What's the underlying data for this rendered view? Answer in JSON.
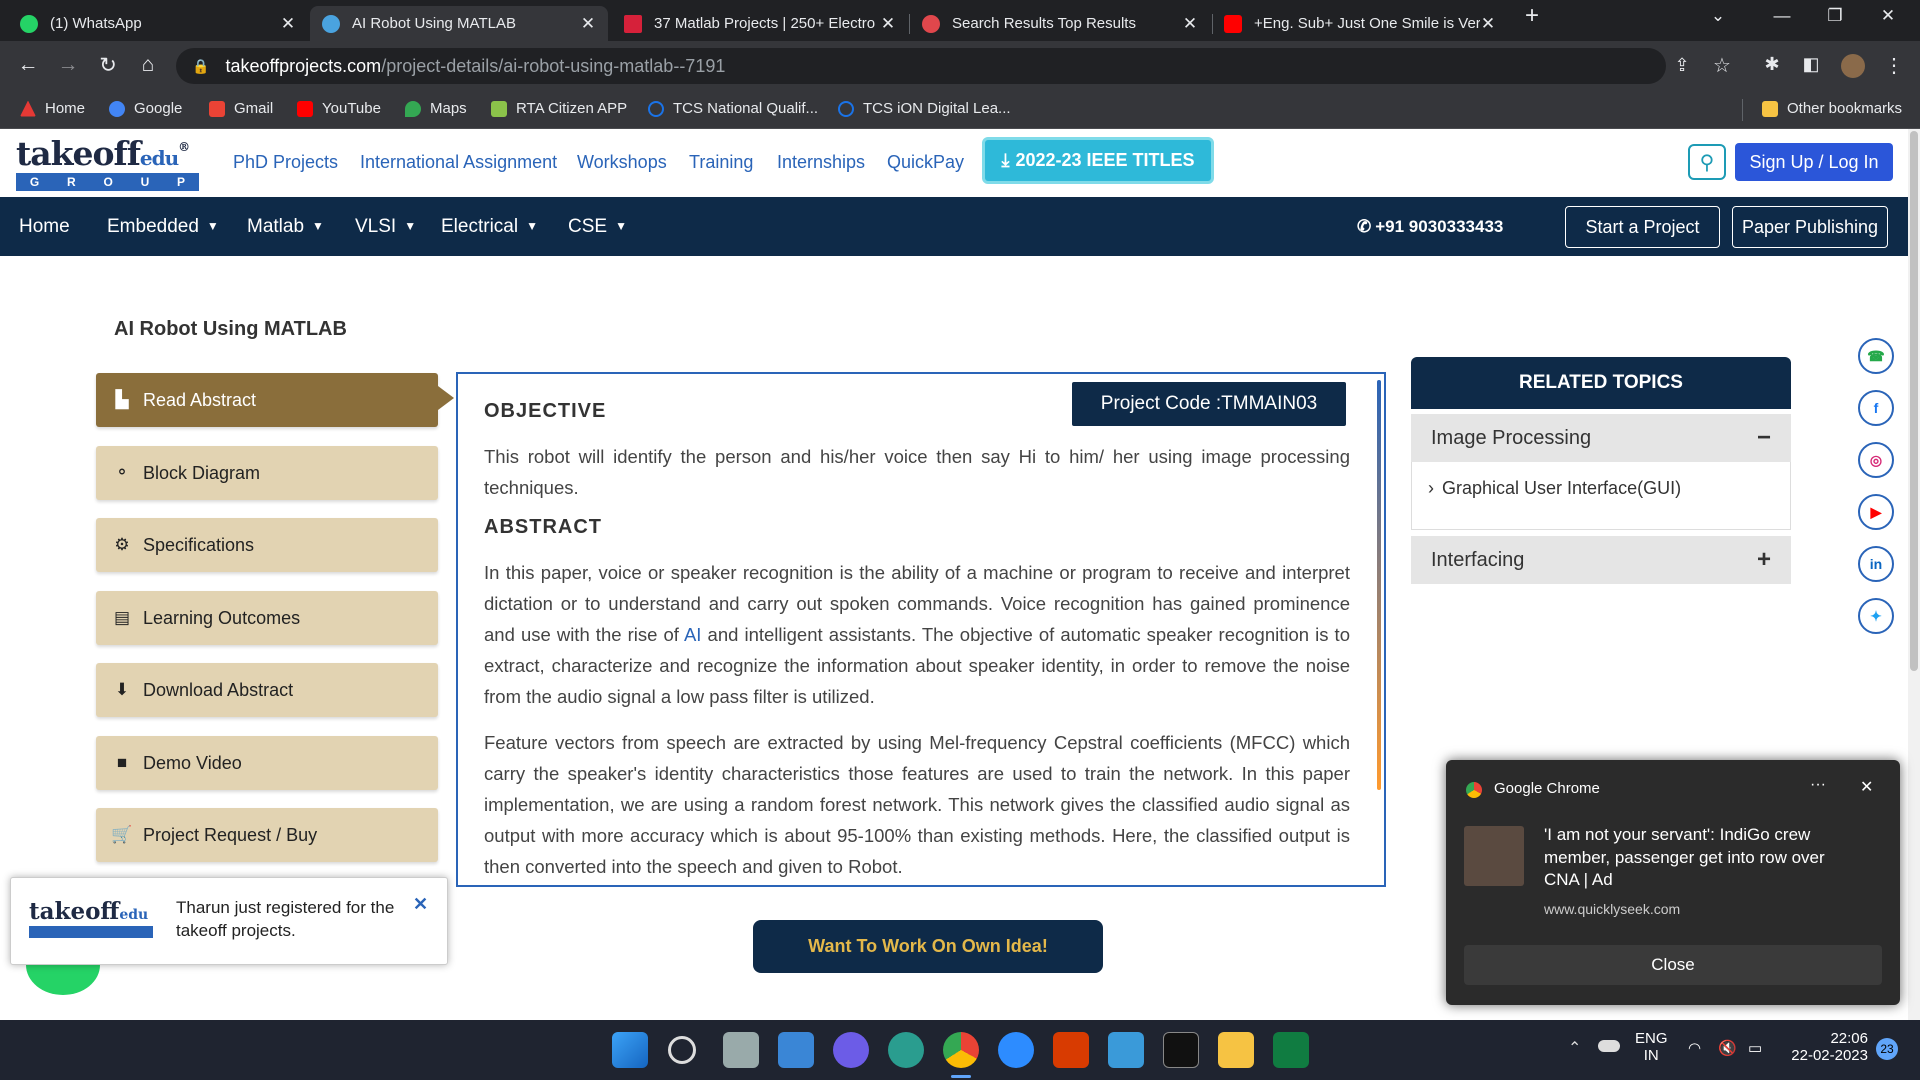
{
  "browser": {
    "tabs": [
      {
        "title": "(1) WhatsApp",
        "color": "#25d366"
      },
      {
        "title": "AI Robot Using MATLAB",
        "color": "#4aa3df"
      },
      {
        "title": "37 Matlab Projects | 250+ Electro",
        "color": "#d6213a"
      },
      {
        "title": "Search Results Top Results",
        "color": "#e0474c"
      },
      {
        "title": "+Eng. Sub+ Just One Smile is Ver",
        "color": "#ff0000"
      }
    ],
    "url_host": "takeoffprojects.com",
    "url_path": "/project-details/ai-robot-using-matlab--7191",
    "bookmarks": [
      {
        "label": "Home",
        "color": "#e53935"
      },
      {
        "label": "Google",
        "color": "#4285f4"
      },
      {
        "label": "Gmail",
        "color": "#ea4335"
      },
      {
        "label": "YouTube",
        "color": "#ff0000"
      },
      {
        "label": "Maps",
        "color": "#34a853"
      },
      {
        "label": "RTA Citizen APP",
        "color": "#8bc34a"
      },
      {
        "label": "TCS National Qualif...",
        "color": "#1a73e8"
      },
      {
        "label": "TCS iON Digital Lea...",
        "color": "#1a73e8"
      }
    ],
    "other_bookmarks": "Other bookmarks"
  },
  "site": {
    "logo_main": "takeoff",
    "logo_edu": "edu",
    "logo_group": [
      "G",
      "R",
      "O",
      "U",
      "P"
    ],
    "top_nav": [
      "PhD Projects",
      "International Assignment",
      "Workshops",
      "Training",
      "Internships",
      "QuickPay"
    ],
    "ieee_button": "2022-23 IEEE TITLES",
    "signup": "Sign Up / Log In",
    "main_nav": [
      "Home",
      "Embedded",
      "Matlab",
      "VLSI",
      "Electrical",
      "CSE"
    ],
    "phone": "+91 9030333433",
    "start_project": "Start a Project",
    "paper_publishing": "Paper Publishing"
  },
  "page": {
    "title": "AI Robot Using MATLAB",
    "side_menu": [
      {
        "label": "Read Abstract",
        "icon": "reader-icon"
      },
      {
        "label": "Block Diagram",
        "icon": "diagram-icon"
      },
      {
        "label": "Specifications",
        "icon": "gears-icon"
      },
      {
        "label": "Learning Outcomes",
        "icon": "book-icon"
      },
      {
        "label": "Download Abstract",
        "icon": "download-icon"
      },
      {
        "label": "Demo Video",
        "icon": "video-icon"
      },
      {
        "label": "Project Request / Buy",
        "icon": "cart-icon"
      }
    ],
    "project_code": "Project Code :TMMAIN03",
    "objective_heading": "OBJECTIVE",
    "objective_text": "This robot will identify the person and his/her voice then say Hi to him/ her using image processing techniques.",
    "abstract_heading": "ABSTRACT",
    "abstract_p1_a": "In this paper, voice or speaker recognition is the ability of a machine or program to receive and interpret dictation or to understand and carry out spoken commands. Voice recognition has gained prominence and use with the rise of ",
    "abstract_p1_link": "AI",
    "abstract_p1_b": " and intelligent assistants. The objective of automatic speaker recognition is to extract, characterize and recognize the information about speaker identity, in order to remove the noise from the audio signal a low pass filter is utilized.",
    "abstract_p2": "Feature vectors from speech are extracted by using Mel-frequency Cepstral coefficients (MFCC) which carry the speaker's identity characteristics those features are used to train the network. In this paper implementation, we are using a random forest network. This network gives the classified audio signal as output with more accuracy which is about 95-100% than existing methods. Here, the classified output is then converted into the speech and given to Robot.",
    "own_idea": "Want To Work On Own Idea!",
    "related_heading": "RELATED TOPICS",
    "related_1": "Image Processing",
    "related_1_item": "Graphical User Interface(GUI)",
    "related_2": "Interfacing"
  },
  "toast": {
    "message": "Tharun just registered for the takeoff projects."
  },
  "notification": {
    "app": "Google Chrome",
    "title": "'I am not your servant': IndiGo crew member, passenger get into row over",
    "source": "CNA | Ad",
    "url": "www.quicklyseek.com",
    "close": "Close"
  },
  "taskbar": {
    "lang": "ENG",
    "region": "IN",
    "time": "22:06",
    "date": "22-02-2023",
    "badge": "23"
  }
}
